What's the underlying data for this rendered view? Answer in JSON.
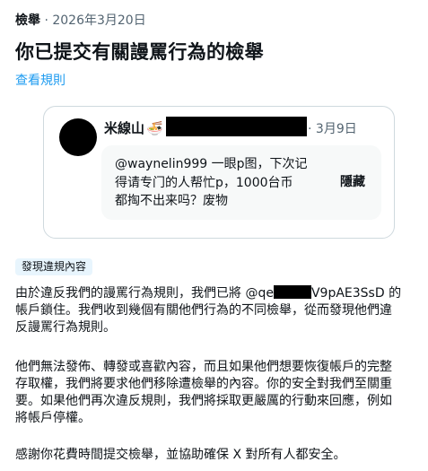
{
  "header": {
    "kind": "檢舉",
    "date": "2026年3月20日",
    "title": "你已提交有關謾罵行為的檢舉",
    "rules_link": "查看規則"
  },
  "reported_post": {
    "author_name": "米線山",
    "author_emoji": "🍜",
    "date": "3月9日",
    "text_lines": [
      "@waynelin999 一眼p图，下次记",
      "得请专门的人帮忙p，1000台币",
      "都掏不出来吗？废物"
    ],
    "hide_label": "隱藏"
  },
  "verdict_badge": "發現違規內容",
  "message": {
    "p1_line1_before": "由於違反我們的謾罵行為規則，我們已將 @qe",
    "p1_line1_after": "V9pAE3SsD 的",
    "p1_line2": "帳戶鎖住。我們收到幾個有關他們行為的不同檢舉，從而發現他們違",
    "p1_line3": "反謾罵行為規則。",
    "p2_lines": [
      "他們無法發佈、轉發或喜歡內容，而且如果他們想要恢復帳戶的完整",
      "存取權，我們將要求他們移除遭檢舉的內容。你的安全對我們至關重",
      "要。如果他們再次違反規則，我們將採取更嚴厲的行動來回應，例如",
      "將帳戶停權。"
    ],
    "p3": "感謝你花費時間提交檢舉，並協助確保 X 對所有人都安全。"
  },
  "colors": {
    "link": "#1d9bf0",
    "secondary_text": "#536471",
    "badge_bg": "#e8f5fd",
    "quote_bg": "#f7f9f9",
    "border": "#cfd9de"
  }
}
